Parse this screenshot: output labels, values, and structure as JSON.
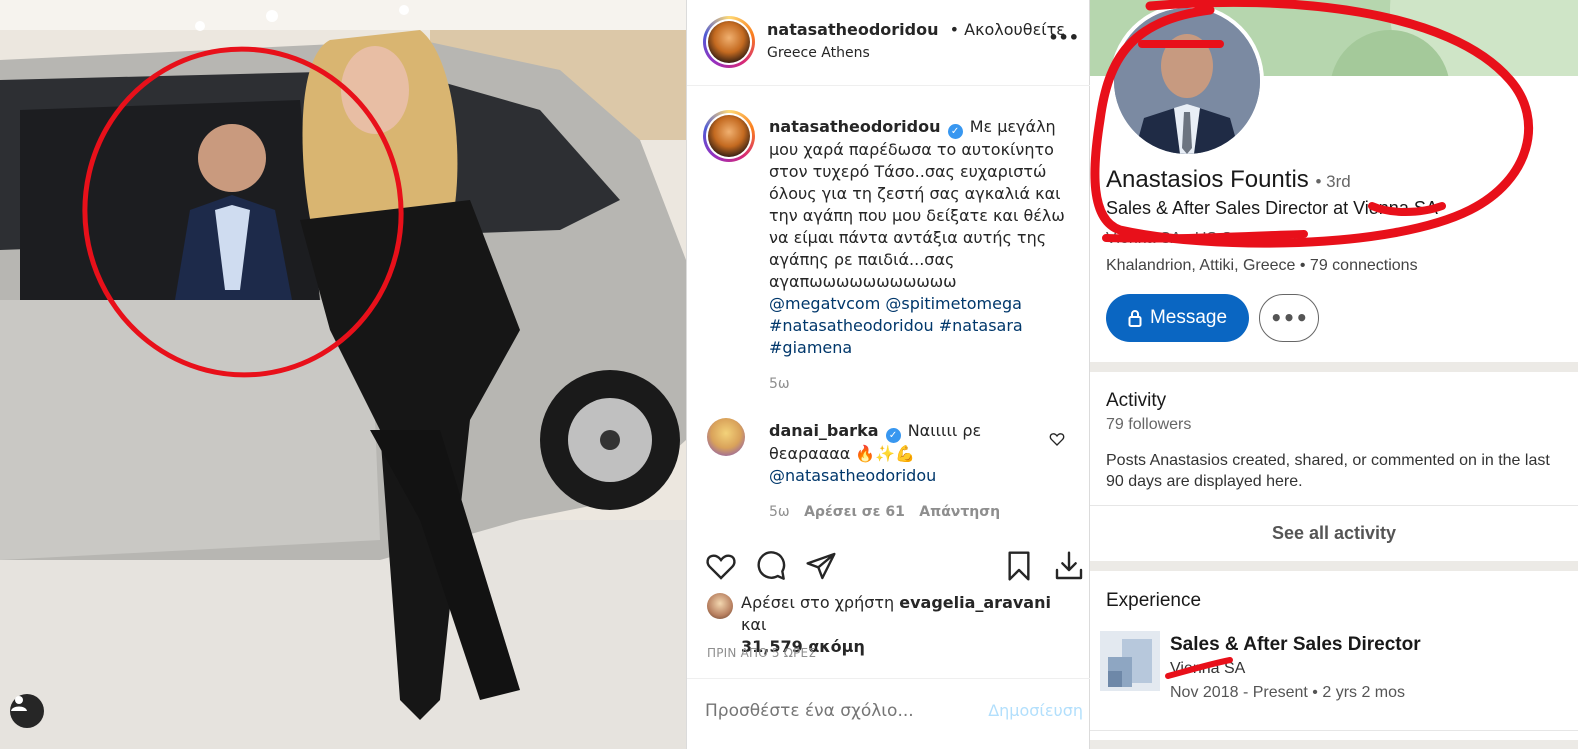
{
  "instagram": {
    "header": {
      "username": "natasatheodoridou",
      "follow_status": "• Ακολουθείτε",
      "location": "Greece Athens",
      "more_label": "•••"
    },
    "caption": {
      "username": "natasatheodoridou",
      "verified": "✓",
      "text": "Με μεγάλη μου χαρά παρέδωσα το αυτοκίνητο στον τυχερό Τάσο..σας ευχαριστώ όλους για τη ζεστή σας αγκαλιά και την αγάπη που μου δείξατε και θέλω να είμαι πάντα αντάξια αυτής της αγάπης ρε παιδιά...σας αγαπωωωωωωωωωωω",
      "mentions": "@megatvcom @spitimetomega",
      "hashtags_1": "#natasatheodoridou #natasara",
      "hashtags_2": "#giamena",
      "time": "5ω"
    },
    "comment": {
      "username": "danai_barka",
      "verified": "✓",
      "text": "Ναιιιιι ρε θεαραααα 🔥✨💪",
      "mention": "@natasatheodoridou",
      "time": "5ω",
      "likes": "Αρέσει σε 61",
      "reply": "Απάντηση"
    },
    "likes": {
      "prefix": "Αρέσει στο χρήστη",
      "user": "evagelia_aravani",
      "and": "και",
      "count": "31,579 ακόμη"
    },
    "timestamp": "ΠΡΙΝ ΑΠΟ 5 ΩΡΕΣ",
    "add_comment": {
      "placeholder": "Προσθέστε ένα σχόλιο...",
      "post_label": "Δημοσίευση"
    },
    "icons": [
      "heart-icon",
      "comment-icon",
      "share-icon",
      "bookmark-icon",
      "download-icon"
    ]
  },
  "linkedin": {
    "name": "Anastasios Fountis",
    "degree": "• 3rd",
    "headline": "Sales & After Sales Director at Vienna SA",
    "subline": "Vienna SA • US San Diego",
    "location": "Khalandrion, Attiki, Greece • 79 connections",
    "message_button": "Message",
    "more_button": "•••",
    "activity": {
      "title": "Activity",
      "followers": "79 followers",
      "description": "Posts Anastasios created, shared, or commented on in the last 90 days are displayed here.",
      "see_all": "See all activity"
    },
    "experience": {
      "title": "Experience",
      "role": "Sales & After Sales Director",
      "company": "Vienna SA",
      "dates": "Nov 2018 - Present • 2 yrs 2 mos"
    },
    "colors": {
      "brand": "#0a66c2",
      "annotation": "#e8101a"
    }
  }
}
